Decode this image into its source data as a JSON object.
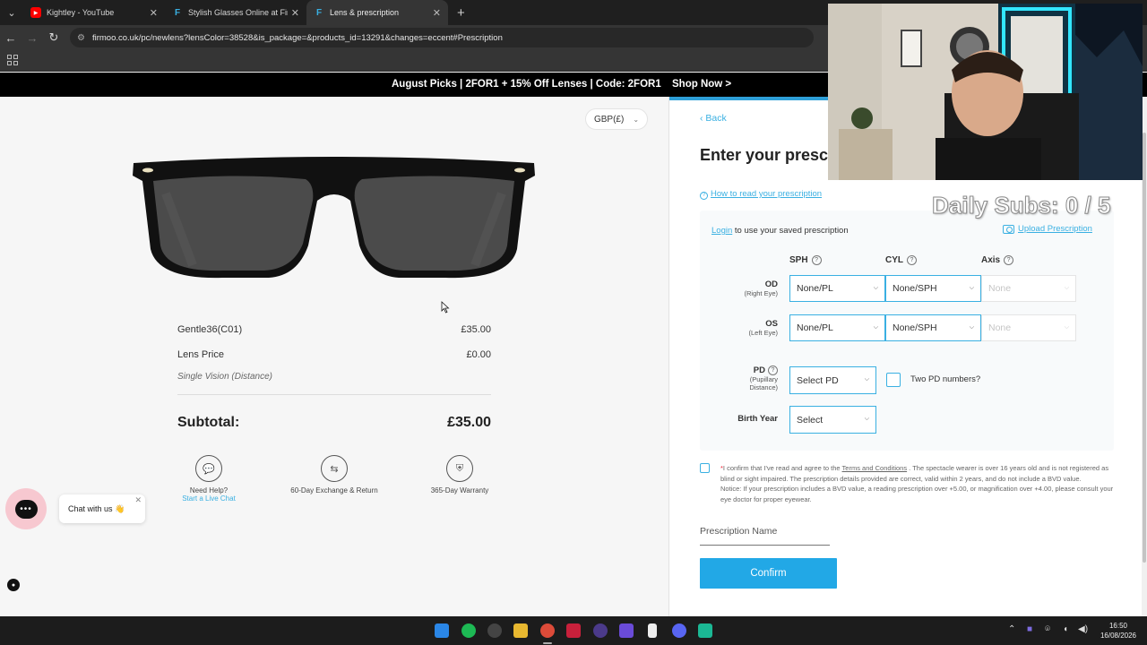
{
  "browser": {
    "tabs": [
      {
        "label": "Kightley - YouTube",
        "favicon": "youtube-icon",
        "active": false
      },
      {
        "label": "Stylish Glasses Online at Firmoo",
        "favicon": "firmoo-icon",
        "active": false
      },
      {
        "label": "Lens & prescription",
        "favicon": "firmoo-icon",
        "active": true
      }
    ],
    "url": "firmoo.co.uk/pc/newlens?lensColor=38528&is_package=&products_id=13291&changes=eccent#Prescription"
  },
  "promo": {
    "text": "August Picks | 2FOR1 + 15% Off Lenses | Code: 2FOR1",
    "shop_now": "Shop Now >"
  },
  "product": {
    "currency": "GBP(£)",
    "frame_name": "Gentle36(C01)",
    "frame_price": "£35.00",
    "lens_label": "Lens Price",
    "lens_price": "£0.00",
    "lens_type": "Single Vision (Distance)",
    "subtotal_label": "Subtotal:",
    "subtotal_value": "£35.00"
  },
  "features": [
    {
      "label": "Need Help?",
      "link": "Start a Live Chat",
      "icon": "chat-icon"
    },
    {
      "label": "60-Day Exchange & Return",
      "icon": "exchange-icon"
    },
    {
      "label": "365-Day Warranty",
      "icon": "warranty-icon"
    }
  ],
  "chat": {
    "label": "Chat with us 👋"
  },
  "prescription": {
    "back": "Back",
    "heading": "Enter your prescription",
    "how_to": "How to read your prescription",
    "login_link": "Login",
    "login_text": " to use your saved prescription",
    "upload": "Upload Prescription",
    "columns": {
      "sph": "SPH",
      "cyl": "CYL",
      "axis": "Axis"
    },
    "od": {
      "label": "OD",
      "sub": "(Right Eye)",
      "sph": "None/PL",
      "cyl": "None/SPH",
      "axis": "None"
    },
    "os": {
      "label": "OS",
      "sub": "(Left Eye)",
      "sph": "None/PL",
      "cyl": "None/SPH",
      "axis": "None"
    },
    "pd": {
      "label": "PD",
      "sub1": "(Pupillary",
      "sub2": "Distance)",
      "value": "Select PD",
      "two_pd": "Two PD numbers?"
    },
    "birth_year": {
      "label": "Birth Year",
      "value": "Select"
    },
    "agree": {
      "asterisk": "*",
      "part1": "I confirm that I've read and agree to the ",
      "terms": "Terms and Conditions",
      "part2": " . The spectacle wearer is over 16 years old and is not registered as blind or sight impaired. The prescription details provided are correct, valid within 2 years, and do not include a BVD value.",
      "notice": "Notice: If your prescription includes a BVD value, a reading prescription over +5.00, or magnification over +4.00, please consult your eye doctor for proper eyewear."
    },
    "name_placeholder": "Prescription Name",
    "confirm": "Confirm"
  },
  "overlay": {
    "subs": "Daily Subs: 0 / 5"
  },
  "taskbar": {
    "time": "16:50",
    "date": "16/08/2026"
  },
  "colors": {
    "accent": "#22a8e6",
    "link": "#3ab0e2",
    "promo_bg": "#000000"
  }
}
